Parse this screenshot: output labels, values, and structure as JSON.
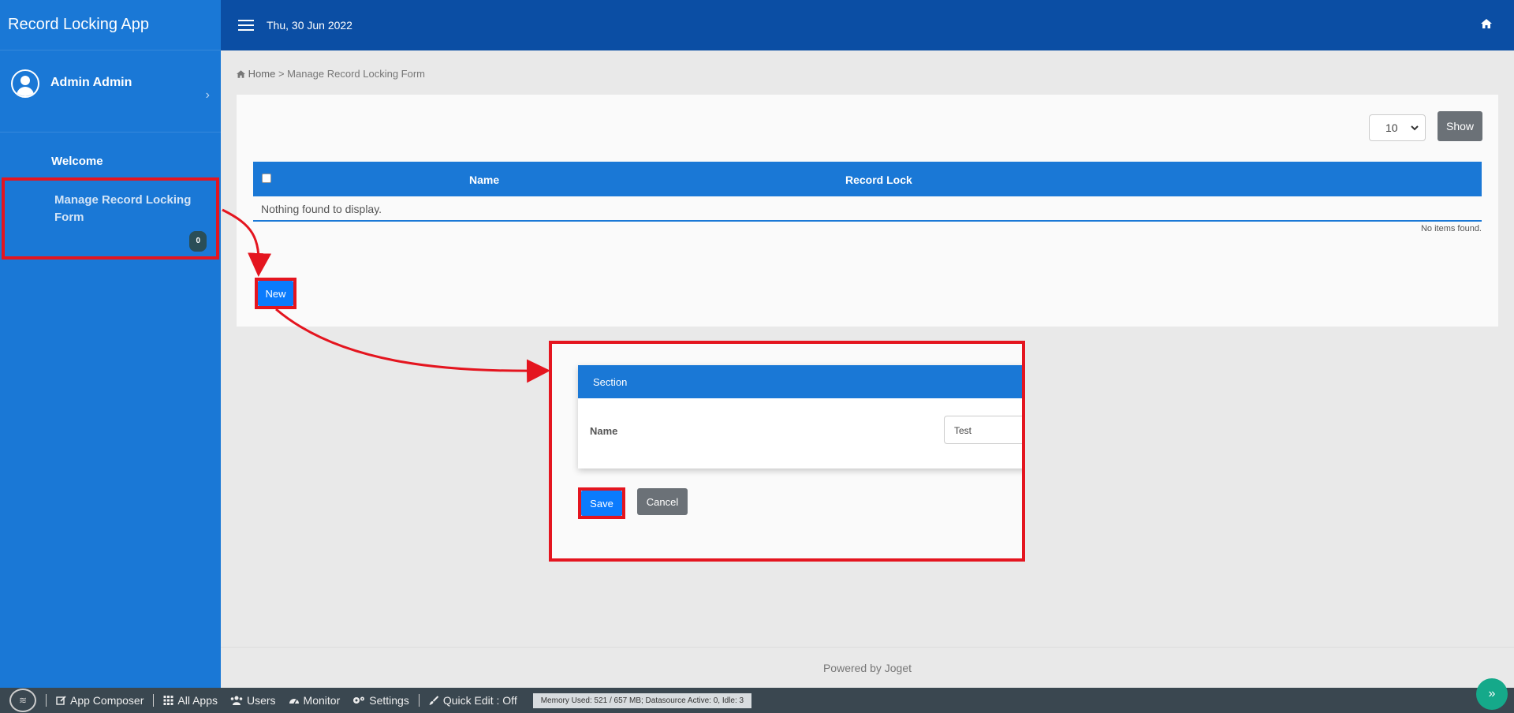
{
  "sidebar": {
    "app_title": "Record Locking App",
    "user_name": "Admin Admin",
    "items": [
      {
        "label": "Welcome"
      },
      {
        "label": "Manage Record Locking Form",
        "badge": "0"
      }
    ]
  },
  "header": {
    "date": "Thu, 30 Jun 2022"
  },
  "breadcrumb": {
    "home": "Home",
    "separator": ">",
    "current": "Manage Record Locking Form"
  },
  "list": {
    "page_size": "10",
    "show_label": "Show",
    "columns": [
      "Name",
      "Record Lock"
    ],
    "empty_message": "Nothing found to display.",
    "no_items": "No items found.",
    "new_label": "New"
  },
  "form": {
    "section_title": "Section",
    "field_label": "Name",
    "field_value": "Test",
    "save_label": "Save",
    "cancel_label": "Cancel"
  },
  "footer": {
    "powered_by": "Powered by Joget"
  },
  "bottombar": {
    "app_composer": "App Composer",
    "all_apps": "All Apps",
    "users": "Users",
    "monitor": "Monitor",
    "settings": "Settings",
    "quick_edit": "Quick Edit : Off",
    "memory": "Memory Used: 521 / 657 MB; Datasource Active: 0, Idle: 3"
  },
  "colors": {
    "sidebar": "#1a78d6",
    "header": "#0b4ea4",
    "primary_button": "#0b7bfd",
    "secondary_button": "#6b7177",
    "highlight": "#e4151f"
  }
}
